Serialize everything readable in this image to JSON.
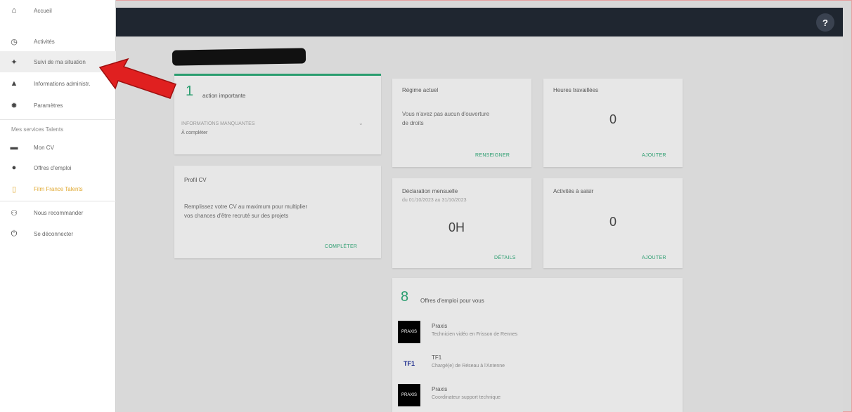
{
  "sidebar": {
    "items": [
      {
        "label": "Accueil",
        "icon": "home-icon",
        "glyph": "⌂"
      },
      {
        "label": "Activités",
        "icon": "clock-icon",
        "glyph": "◷"
      },
      {
        "label": "Suivi de ma situation",
        "icon": "person-thumb-icon",
        "glyph": "✦"
      },
      {
        "label": "Informations administr.",
        "icon": "person-icon",
        "glyph": "▲"
      },
      {
        "label": "Paramètres",
        "icon": "gear-icon",
        "glyph": "✹"
      }
    ],
    "section_label": "Mes services Talents",
    "services": [
      {
        "label": "Mon CV",
        "icon": "briefcase-icon",
        "glyph": "▬"
      },
      {
        "label": "Offres d'emploi",
        "icon": "person-pin-icon",
        "glyph": "●"
      },
      {
        "label": "Film France Talents",
        "icon": "film-icon",
        "glyph": "▯"
      }
    ],
    "bottom": [
      {
        "label": "Nous recommander",
        "icon": "people-icon",
        "glyph": "⚇"
      },
      {
        "label": "Se déconnecter",
        "icon": "power-icon",
        "glyph": "⏻"
      }
    ]
  },
  "topbar": {
    "help_glyph": "?"
  },
  "actions_card": {
    "count": "1",
    "title": "action importante",
    "item_label": "INFORMATIONS MANQUANTES",
    "item_status": "À compléter"
  },
  "cv_card": {
    "title": "Profil CV",
    "text_line1": "Remplissez votre CV au maximum pour multiplier",
    "text_line2": "vos chances d'être recruté sur des projets",
    "link": "COMPLÉTER"
  },
  "regime_card": {
    "title": "Régime actuel",
    "text_line1": "Vous n'avez pas aucun d'ouverture",
    "text_line2": "de droits",
    "link": "RENSEIGNER"
  },
  "hours_card": {
    "title": "Heures travaillées",
    "value": "0",
    "link": "AJOUTER"
  },
  "monthly_card": {
    "title": "Déclaration mensuelle",
    "subtitle": "du 01/10/2023 au 31/10/2023",
    "value": "0H",
    "link": "DÉTAILS"
  },
  "events_card": {
    "title": "Activités à saisir",
    "value": "0",
    "link": "AJOUTER"
  },
  "jobs_card": {
    "count": "8",
    "title": "Offres d'emploi pour vous",
    "jobs": [
      {
        "logo": "PRAXIS",
        "company": "Praxis",
        "title": "Technicien vidéo en Frisson de Rennes"
      },
      {
        "logo": "TF1",
        "company": "TF1",
        "title": "Chargé(e) de Réseau à l'Antenne"
      },
      {
        "logo": "PRAXIS",
        "company": "Praxis",
        "title": "Coordinateur support technique"
      }
    ]
  },
  "colors": {
    "accent": "#2a9d6f",
    "topbar": "#1f2630",
    "highlight": "#e0a830",
    "arrow": "#e02020"
  }
}
